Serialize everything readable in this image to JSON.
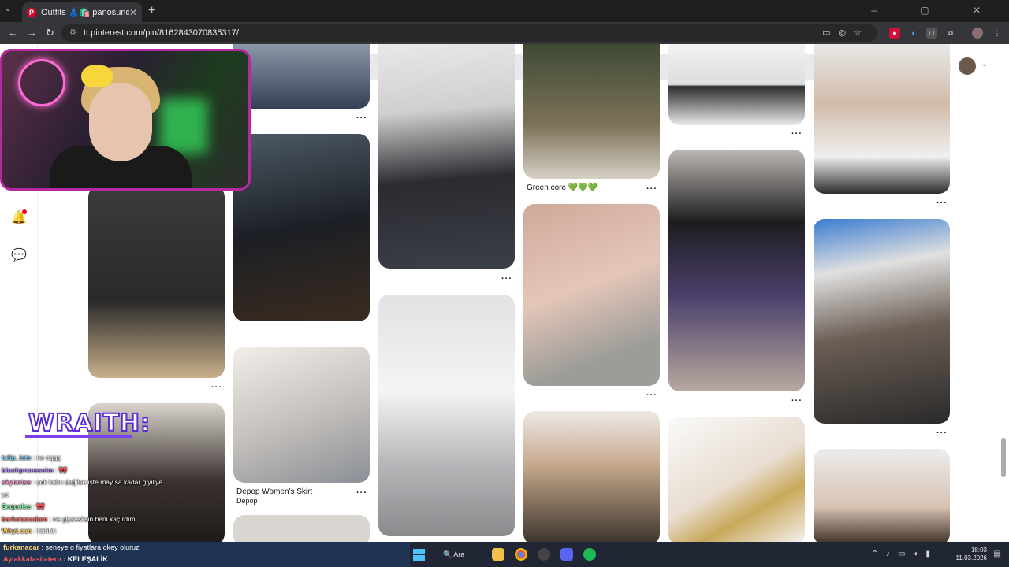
{
  "browser": {
    "tab_title": "Outfits 👗🛍️ panosundaki Pin",
    "tab_close": "✕",
    "new_tab": "+",
    "tab_menu": "⌄",
    "url": "tr.pinterest.com/pin/8162843070835317/",
    "window_controls": "– ▢ ✕"
  },
  "pins": {
    "green_core_caption": "Green core 💚💚💚",
    "skirt_title": "Depop Women's Skirt",
    "skirt_subtitle": "Depop",
    "more": "···"
  },
  "stream": {
    "overlay_title": "WRAITH:",
    "chat": [
      {
        "user": "tulip_iste",
        "text": " : ne nggg"
      },
      {
        "user": "blushpruneseim",
        "text": " : 🎀"
      },
      {
        "user": "skytartse",
        "text": " : çok kalın değilse işte mayısa kadar giyiliye yo"
      },
      {
        "user": "Sequelse",
        "text": " : 🎀"
      },
      {
        "user": "barkotanadam",
        "text": " : ne giysesksin beni kaçırdım"
      },
      {
        "user": "WhyLoan",
        "text": " : hhhhh"
      }
    ],
    "bottom_chat": [
      {
        "user": "furkanacar",
        "text": " : seneye o fiyatlara okey oluruz"
      },
      {
        "user": "Aylakkafasilatern",
        "text": " : KELEŞALİK"
      }
    ]
  },
  "taskbar": {
    "search": "Ara",
    "time": "18:03",
    "date": "11.03.2026"
  }
}
